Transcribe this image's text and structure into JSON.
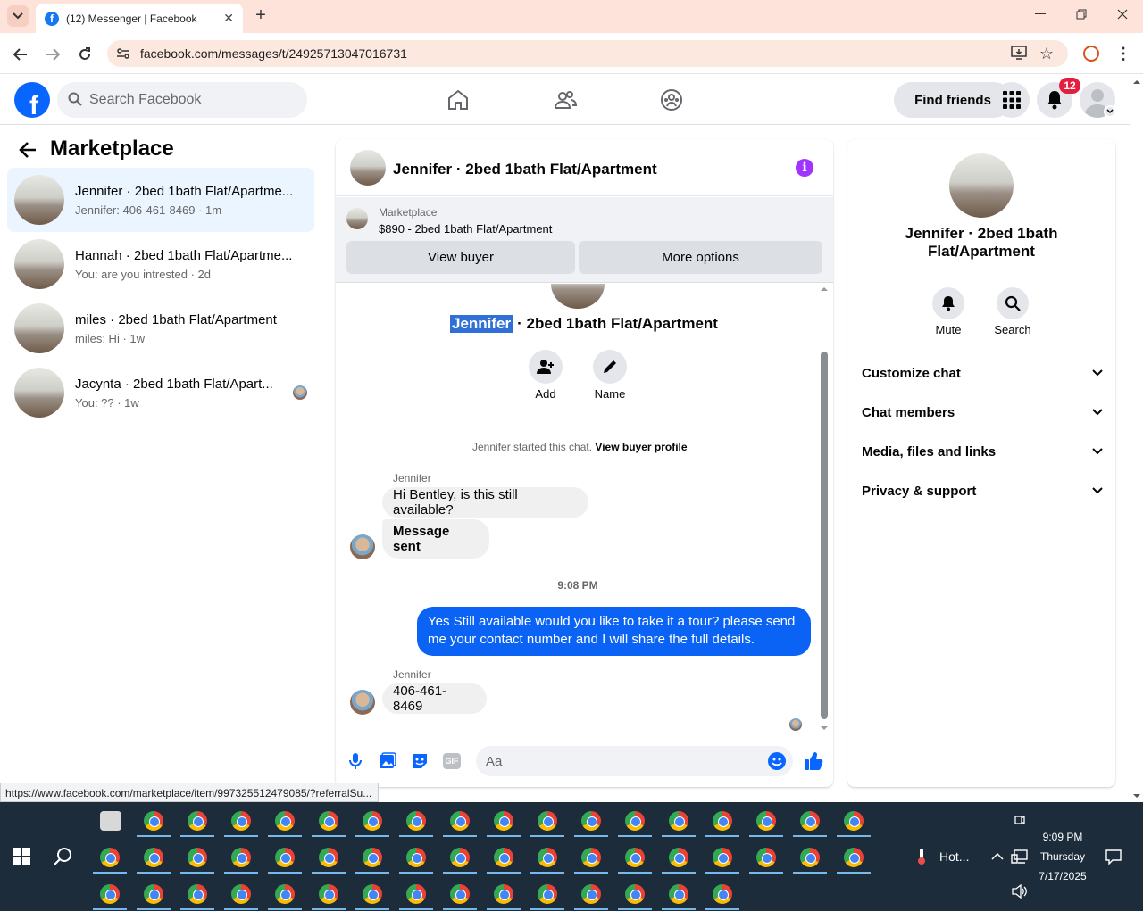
{
  "browser": {
    "tab_title": "(12) Messenger | Facebook",
    "url": "facebook.com/messages/t/24925713047016731",
    "status_url": "https://www.facebook.com/marketplace/item/997325512479085/?referralSu..."
  },
  "header": {
    "search_placeholder": "Search Facebook",
    "find_friends": "Find friends",
    "notif_count": "12"
  },
  "sidebar": {
    "title": "Marketplace",
    "conversations": [
      {
        "name": "Jennifer · 2bed 1bath Flat/Apartme...",
        "sub": "Jennifer: 406-461-8469 · 1m"
      },
      {
        "name": "Hannah · 2bed 1bath Flat/Apartme...",
        "sub": "You: are you intrested · 2d"
      },
      {
        "name": "miles · 2bed 1bath Flat/Apartment",
        "sub": "miles: Hi · 1w"
      },
      {
        "name": "Jacynta · 2bed 1bath Flat/Apart...",
        "sub": "You: ?? · 1w"
      }
    ]
  },
  "chat": {
    "header_title": "Jennifer · 2bed 1bath Flat/Apartment",
    "mp_label": "Marketplace",
    "mp_item": "$890 - 2bed 1bath Flat/Apartment",
    "view_buyer": "View buyer",
    "more_options": "More options",
    "intro_name_highlight": "Jennifer",
    "intro_name_rest": "· 2bed 1bath Flat/Apartment",
    "add_label": "Add",
    "name_label": "Name",
    "started_text": "Jennifer started this chat.",
    "view_buyer_profile": "View buyer profile",
    "sender1": "Jennifer",
    "msg1": "Hi Bentley, is this still available?",
    "msg2": "Message sent",
    "time1": "9:08 PM",
    "msg3": "Yes Still available would you like to take it a tour? please send me your contact number and I will share the full details.",
    "sender2": "Jennifer",
    "msg4": "406-461-8469",
    "composer_placeholder": "Aa"
  },
  "info": {
    "title": "Jennifer · 2bed 1bath Flat/Apartment",
    "mute": "Mute",
    "search": "Search",
    "sections": [
      "Customize chat",
      "Chat members",
      "Media, files and links",
      "Privacy & support"
    ]
  },
  "taskbar": {
    "weather": "Hot...",
    "time": "9:09 PM",
    "day": "Thursday",
    "date": "7/17/2025"
  },
  "colors": {
    "accent": "#0866ff",
    "messenger_purple": "#a033ff",
    "outgoing_bubble": "#0a63f5"
  }
}
